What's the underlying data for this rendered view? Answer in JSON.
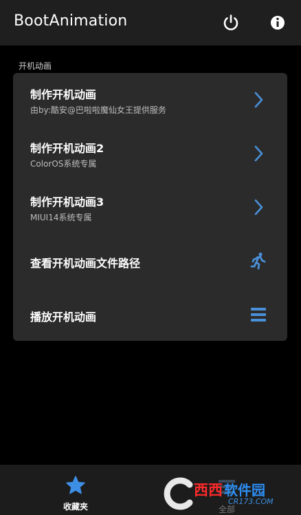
{
  "app": {
    "title": "BootAnimation"
  },
  "toolbar": {
    "power_icon": "power-icon",
    "info_icon": "info-icon"
  },
  "section": {
    "label": "开机动画"
  },
  "menu": [
    {
      "title": "制作开机动画",
      "subtitle": "由by:酷安@巴啦啦魔仙女王提供服务",
      "icon": "chevron-right-icon"
    },
    {
      "title": "制作开机动画2",
      "subtitle": "ColorOS系统专属",
      "icon": "chevron-right-icon"
    },
    {
      "title": "制作开机动画3",
      "subtitle": "MIUI14系统专属",
      "icon": "chevron-right-icon"
    },
    {
      "title": "查看开机动画文件路径",
      "icon": "running-person-icon"
    },
    {
      "title": "播放开机动画",
      "icon": "menu-lines-icon"
    }
  ],
  "bottom_nav": {
    "favorites_label": "收藏夹",
    "all_label": "全部"
  },
  "watermark": {
    "brand_a": "西西",
    "brand_b": "软件园",
    "url": "CR173.COM"
  },
  "colors": {
    "accent": "#4a90d9",
    "card": "#2b2b2b",
    "appbar": "#1f1f1f",
    "star": "#3d8fe6"
  }
}
